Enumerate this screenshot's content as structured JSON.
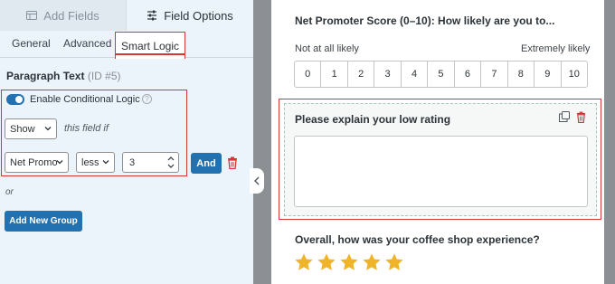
{
  "left_panel": {
    "top_tabs": [
      {
        "label": "Add Fields",
        "icon": "fields-table-icon"
      },
      {
        "label": "Field Options",
        "icon": "sliders-icon"
      }
    ],
    "sub_tabs": [
      {
        "label": "General"
      },
      {
        "label": "Advanced"
      },
      {
        "label": "Smart Logic",
        "active": true
      }
    ],
    "field_title": "Paragraph Text",
    "field_id": "(ID #5)",
    "toggle": {
      "label": "Enable Conditional Logic",
      "enabled": true
    },
    "action_select": "Show",
    "this_field_if": "this field if",
    "rule": {
      "field_select": "Net Promoter Score",
      "operator_select": "less",
      "value": "3",
      "and_button": "And"
    },
    "or_text": "or",
    "add_group_button": "Add New Group"
  },
  "preview": {
    "nps": {
      "title": "Net Promoter Score (0–10): How likely are you to...",
      "low_label": "Not at all likely",
      "high_label": "Extremely likely",
      "scale": [
        "0",
        "1",
        "2",
        "3",
        "4",
        "5",
        "6",
        "7",
        "8",
        "9",
        "10"
      ]
    },
    "paragraph_field": {
      "label": "Please explain your low rating"
    },
    "rating": {
      "question": "Overall, how was your coffee shop experience?",
      "stars": 5
    }
  },
  "colors": {
    "accent_blue": "#2271b1",
    "highlight_red": "#d63638",
    "star_gold": "#f0b429",
    "panel_bg": "#ebf3fb"
  }
}
